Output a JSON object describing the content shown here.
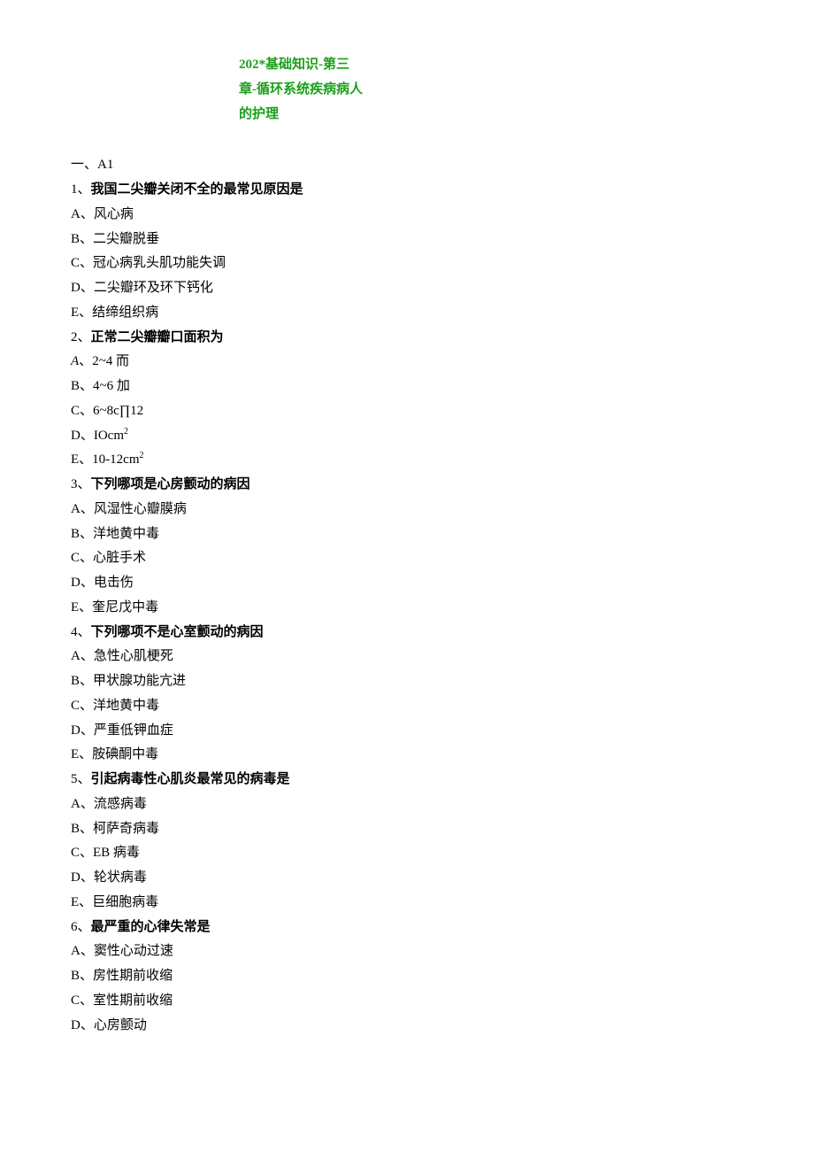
{
  "title": "202*基础知识-第三章-循环系统疾病病人的护理",
  "section_heading": "一、A1",
  "questions": [
    {
      "num": "1、",
      "text": "我国二尖瓣关闭不全的最常见原因是",
      "options": [
        "A、风心病",
        "B、二尖瓣脱垂",
        "C、冠心病乳头肌功能失调",
        "D、二尖瓣环及环下钙化",
        "E、结缔组织病"
      ]
    },
    {
      "num": "2、",
      "text": "正常二尖瓣瓣口面积为",
      "options": [
        "A、2~4 而",
        "B、4~6 加",
        "C、6~8c∏12",
        "D、IOcm²",
        "E、10-12cm²"
      ]
    },
    {
      "num": "3、",
      "text": "下列哪项是心房颤动的病因",
      "options": [
        "A、风湿性心瓣膜病",
        "B、洋地黄中毒",
        "C、心脏手术",
        "D、电击伤",
        "E、奎尼戊中毒"
      ]
    },
    {
      "num": "4、",
      "text": "下列哪项不是心室颤动的病因",
      "options": [
        "A、急性心肌梗死",
        "B、甲状腺功能亢进",
        "C、洋地黄中毒",
        "D、严重低钾血症",
        "E、胺碘酮中毒"
      ]
    },
    {
      "num": "5、",
      "text": "引起病毒性心肌炎最常见的病毒是",
      "options": [
        "A、流感病毒",
        "B、柯萨奇病毒",
        "C、EB 病毒",
        "D、轮状病毒",
        "E、巨细胞病毒"
      ]
    },
    {
      "num": "6、",
      "text": "最严重的心律失常是",
      "options": [
        "A、窦性心动过速",
        "B、房性期前收缩",
        "C、室性期前收缩",
        "D、心房颤动"
      ]
    }
  ]
}
